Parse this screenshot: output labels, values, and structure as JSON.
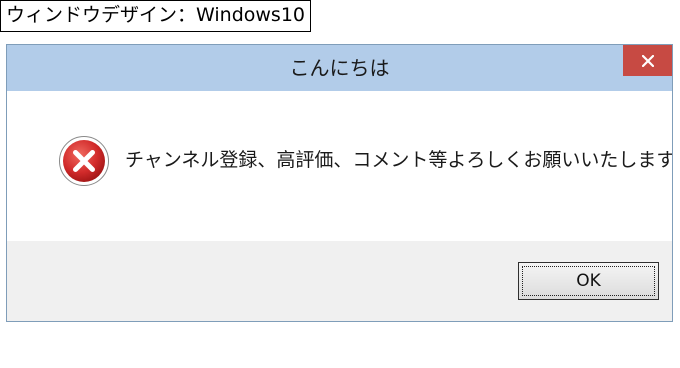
{
  "caption": {
    "text": "ウィンドウデザイン：Windows10"
  },
  "dialog": {
    "title": "こんにちは",
    "close_icon": "close-icon",
    "message": "チャンネル登録、高評価、コメント等よろしくお願いいたします！",
    "status_icon": "error-icon",
    "ok_label": "OK"
  },
  "colors": {
    "title_bar": "#b2cce9",
    "close_button": "#c74a43",
    "footer": "#f0f0f0",
    "error_icon": "#d22b2b",
    "window_border": "#7f9db9"
  }
}
